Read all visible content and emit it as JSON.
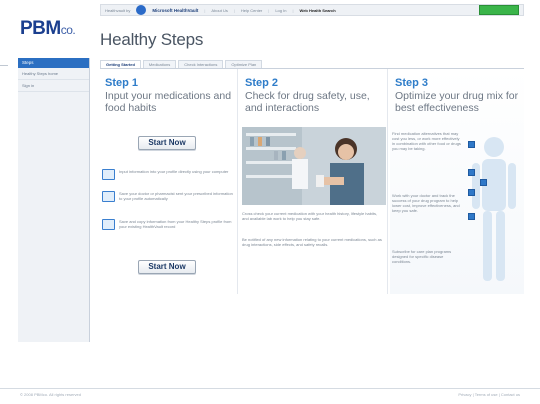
{
  "brand": {
    "name": "PBM",
    "suffix": "co."
  },
  "topbar": {
    "prefix": "Healthvault by",
    "product": "Microsoft HealthVault",
    "links": [
      "About Us",
      "Help Center",
      "Log In"
    ],
    "search_label": "Web Health Search",
    "signin_label": ""
  },
  "sidebar": {
    "header": "Steps",
    "items": [
      "Healthy Steps home",
      "Sign in"
    ]
  },
  "page": {
    "title": "Healthy Steps"
  },
  "tabs": [
    "Getting Started",
    "Medications",
    "Check Interactions",
    "Optimize Plan"
  ],
  "steps": {
    "step1": {
      "title": "Step 1",
      "desc": "Input your medications and food habits",
      "button": "Start Now",
      "features": [
        "Input information into your profile directly using your computer",
        "Save your doctor or pharmacist sent your prescribed information to your profile automatically",
        "Save and copy information from your Healthy Steps profile from your existing HealthVault record"
      ],
      "button2": "Start Now"
    },
    "step2": {
      "title": "Step 2",
      "desc": "Check for drug safety, use, and interactions",
      "para1": "Cross check your current medication with your health history, lifestyle habits, and available lab work to help you stay safe.",
      "para2": "Be notified of any new information relating to your current medications, such as drug interactions, side effects, and safety recalls."
    },
    "step3": {
      "title": "Step 3",
      "desc": "Optimize your drug mix for best effectiveness",
      "para1": "Find medication alternatives that may cost you less, or work more effectively in combination with other food or drugs you may be taking.",
      "para2": "Work with your doctor and track the success of your drug program to help lower cost, improve effectiveness, and keep you safe.",
      "para3": "Subscribe for care plan programs designed for specific disease conditions."
    }
  },
  "footer": {
    "left": "© 2008 PBMco. All rights reserved",
    "right": "Privacy | Terms of use | Contact us"
  },
  "colors": {
    "accent": "#2e7cc9",
    "brand": "#1b3f8f",
    "signin": "#3ab54a"
  }
}
